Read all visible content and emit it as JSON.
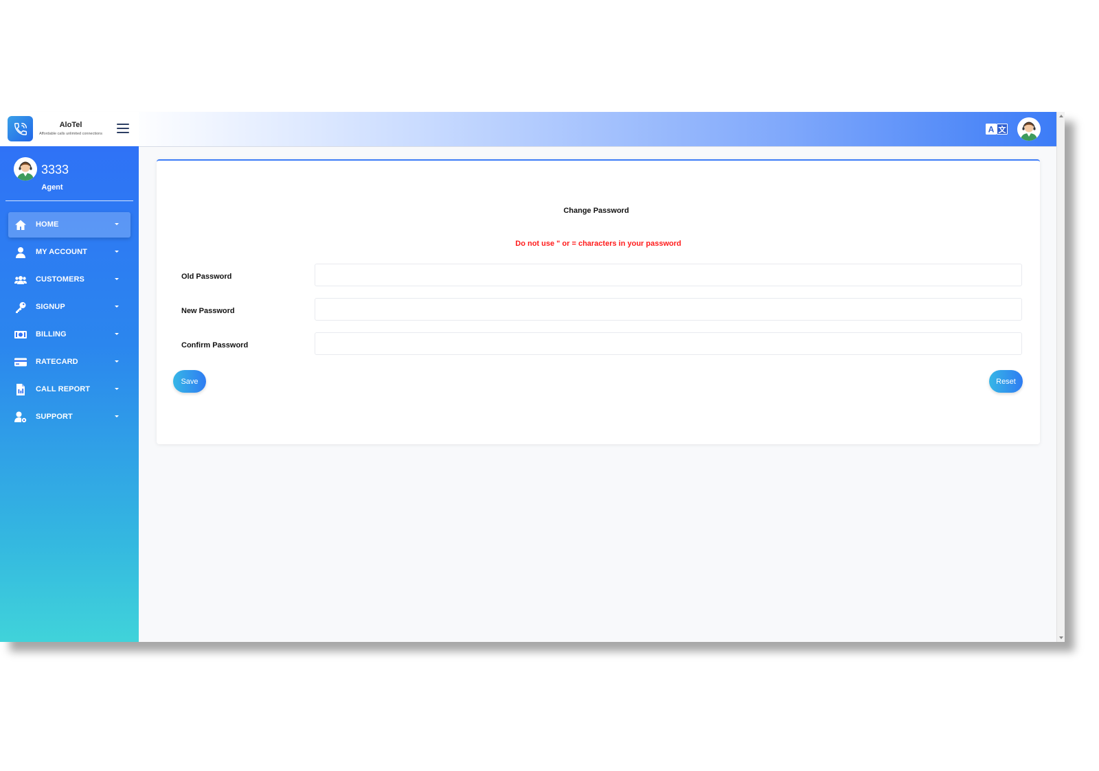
{
  "brand": {
    "name": "AloTel",
    "tagline": "Affordable calls unlimited connections"
  },
  "header": {
    "language_icon": "translate-icon",
    "menu_icon": "hamburger-menu-icon"
  },
  "user": {
    "name": "3333",
    "role": "Agent"
  },
  "sidebar": {
    "items": [
      {
        "label": "HOME",
        "icon": "home-icon",
        "active": true
      },
      {
        "label": "MY ACCOUNT",
        "icon": "user-icon"
      },
      {
        "label": "CUSTOMERS",
        "icon": "users-icon"
      },
      {
        "label": "SIGNUP",
        "icon": "key-icon"
      },
      {
        "label": "BILLING",
        "icon": "money-icon"
      },
      {
        "label": "RATECARD",
        "icon": "credit-card-icon"
      },
      {
        "label": "CALL REPORT",
        "icon": "report-icon"
      },
      {
        "label": "SUPPORT",
        "icon": "user-cog-icon"
      }
    ]
  },
  "form": {
    "title": "Change Password",
    "warning": "Do not use \" or = characters in your password",
    "fields": [
      {
        "label": "Old Password",
        "value": ""
      },
      {
        "label": "New Password",
        "value": ""
      },
      {
        "label": "Confirm Password",
        "value": ""
      }
    ],
    "save_label": "Save",
    "reset_label": "Reset"
  },
  "colors": {
    "accent": "#2f72f6",
    "warning": "#ff1a1a",
    "sidebar_bottom": "#40d3da"
  }
}
